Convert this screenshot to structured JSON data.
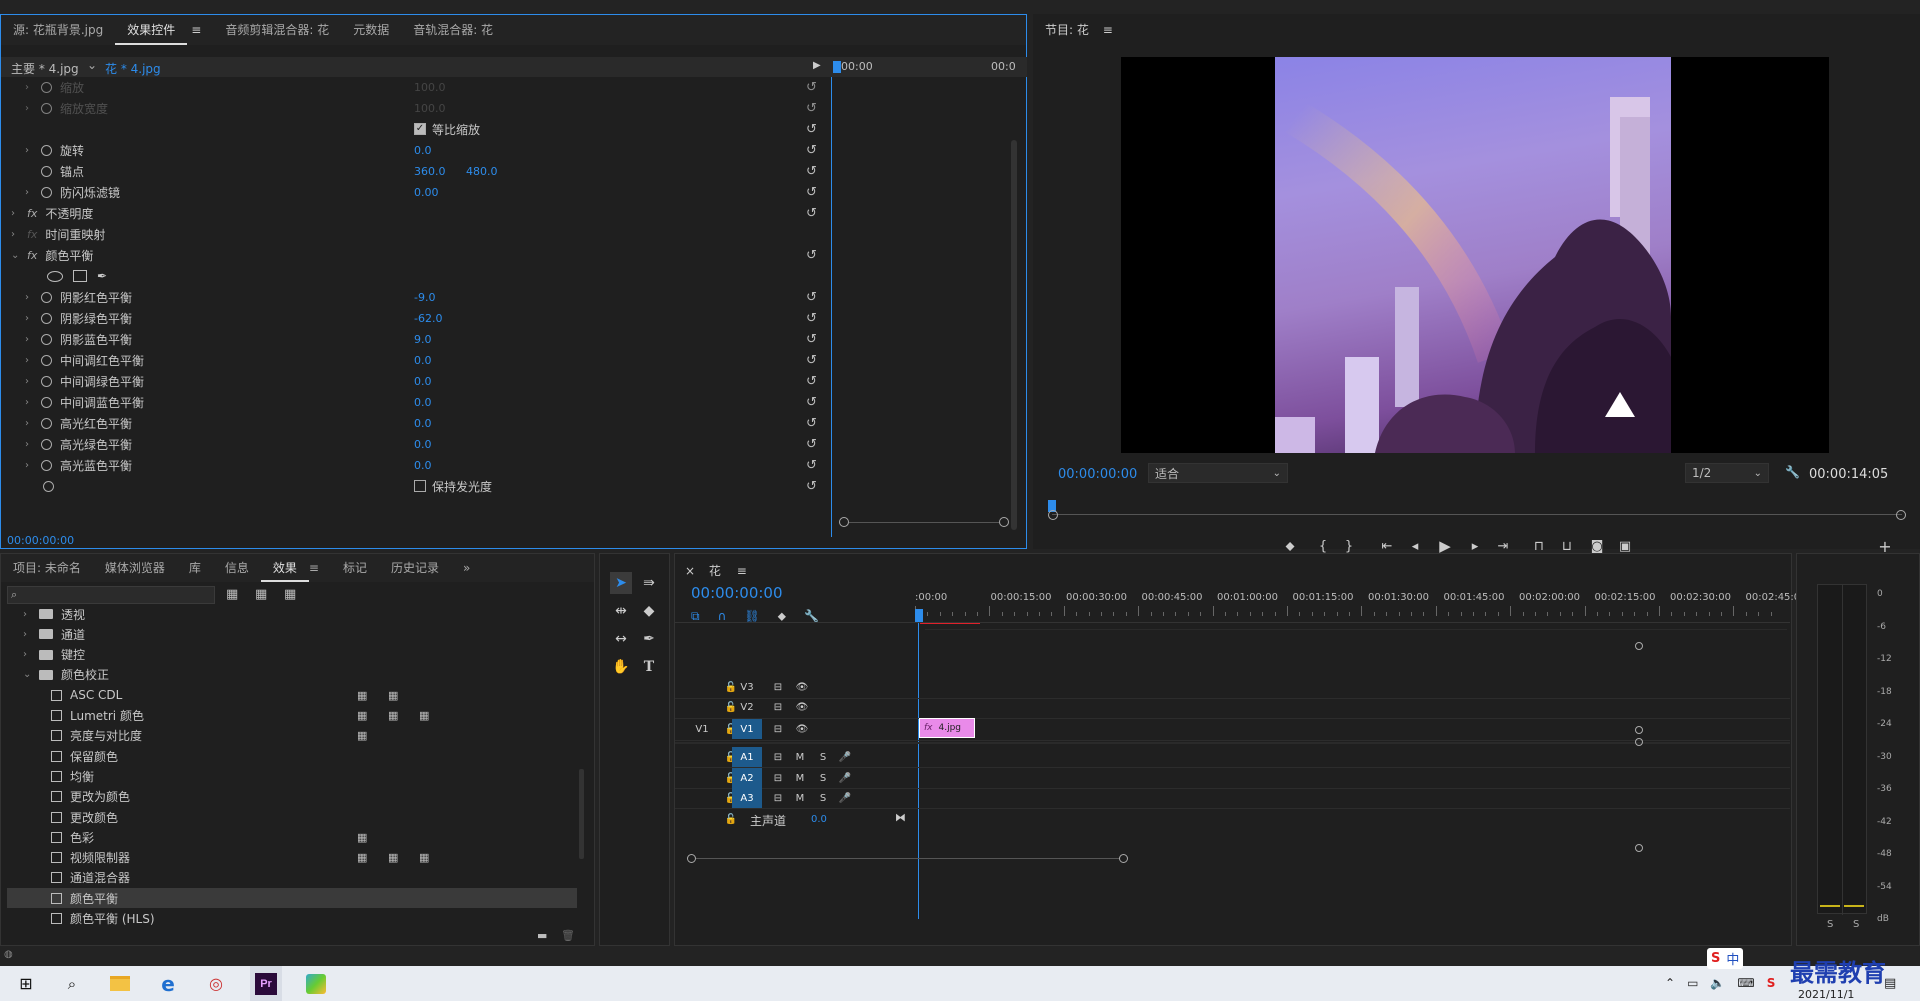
{
  "effect_panel": {
    "tabs": [
      "源: 花瓶背景.jpg",
      "效果控件",
      "音频剪辑混合器: 花",
      "元数据",
      "音轨混合器: 花"
    ],
    "active_tab": "效果控件",
    "master_label": "主要 * 4.jpg",
    "clip_label": "花 * 4.jpg",
    "time_start": "00:00",
    "time_end": "00:0",
    "footer_time": "00:00:00:00",
    "rows": [
      {
        "name": "缩放",
        "value": "100.0"
      },
      {
        "name": "缩放宽度",
        "value": "100.0"
      },
      {
        "name": "等比缩放"
      },
      {
        "name": "旋转",
        "value": "0.0"
      },
      {
        "name": "锚点",
        "value": "360.0",
        "value2": "480.0"
      },
      {
        "name": "防闪烁滤镜",
        "value": "0.00"
      },
      {
        "name": "不透明度"
      },
      {
        "name": "时间重映射"
      },
      {
        "name": "颜色平衡"
      },
      {
        "name": "阴影红色平衡",
        "value": "-9.0"
      },
      {
        "name": "阴影绿色平衡",
        "value": "-62.0"
      },
      {
        "name": "阴影蓝色平衡",
        "value": "9.0"
      },
      {
        "name": "中间调红色平衡",
        "value": "0.0"
      },
      {
        "name": "中间调绿色平衡",
        "value": "0.0"
      },
      {
        "name": "中间调蓝色平衡",
        "value": "0.0"
      },
      {
        "name": "高光红色平衡",
        "value": "0.0"
      },
      {
        "name": "高光绿色平衡",
        "value": "0.0"
      },
      {
        "name": "高光蓝色平衡",
        "value": "0.0"
      },
      {
        "name": "保持发光度"
      }
    ],
    "fx_label": "fx"
  },
  "program": {
    "title": "节目: 花",
    "timecode": "00:00:00:00",
    "fit": "适合",
    "resolution": "1/2",
    "duration": "00:00:14:05"
  },
  "project_panel": {
    "tabs": [
      "项目: 未命名",
      "媒体浏览器",
      "库",
      "信息",
      "效果",
      "标记",
      "历史记录"
    ],
    "active_tab": "效果",
    "items": [
      {
        "label": "透视",
        "type": "folder",
        "indent": 1
      },
      {
        "label": "通道",
        "type": "folder",
        "indent": 1
      },
      {
        "label": "键控",
        "type": "folder",
        "indent": 1
      },
      {
        "label": "颜色校正",
        "type": "folder",
        "indent": 1,
        "open": true
      },
      {
        "label": "ASC CDL",
        "type": "effect",
        "indent": 2
      },
      {
        "label": "Lumetri 颜色",
        "type": "effect",
        "indent": 2
      },
      {
        "label": "亮度与对比度",
        "type": "effect",
        "indent": 2
      },
      {
        "label": "保留颜色",
        "type": "effect",
        "indent": 2
      },
      {
        "label": "均衡",
        "type": "effect",
        "indent": 2
      },
      {
        "label": "更改为颜色",
        "type": "effect",
        "indent": 2
      },
      {
        "label": "更改颜色",
        "type": "effect",
        "indent": 2
      },
      {
        "label": "色彩",
        "type": "effect",
        "indent": 2
      },
      {
        "label": "视频限制器",
        "type": "effect",
        "indent": 2
      },
      {
        "label": "通道混合器",
        "type": "effect",
        "indent": 2
      },
      {
        "label": "颜色平衡",
        "type": "effect",
        "indent": 2,
        "selected": true
      },
      {
        "label": "颜色平衡 (HLS)",
        "type": "effect",
        "indent": 2
      }
    ]
  },
  "timeline": {
    "title": "花",
    "timecode": "00:00:00:00",
    "ruler": [
      ":00:00",
      "00:00:15:00",
      "00:00:30:00",
      "00:00:45:00",
      "00:01:00:00",
      "00:01:15:00",
      "00:01:30:00",
      "00:01:45:00",
      "00:02:00:00",
      "00:02:15:00",
      "00:02:30:00",
      "00:02:45:00"
    ],
    "video_tracks": [
      "V3",
      "V2",
      "V1"
    ],
    "audio_tracks": [
      "A1",
      "A2",
      "A3"
    ],
    "source_track": "V1",
    "master_label": "主声道",
    "master_value": "0.0",
    "clip_label": "4.jpg",
    "mute": "M",
    "solo": "S"
  },
  "meter": {
    "scale": [
      "0",
      "-6",
      "-12",
      "-18",
      "-24",
      "-30",
      "-36",
      "-42",
      "-48",
      "-54",
      "dB"
    ],
    "solo_labels": [
      "S",
      "S"
    ]
  },
  "taskbar": {
    "date": "2021/11/1",
    "ime": "中",
    "watermark": "最需教育"
  }
}
